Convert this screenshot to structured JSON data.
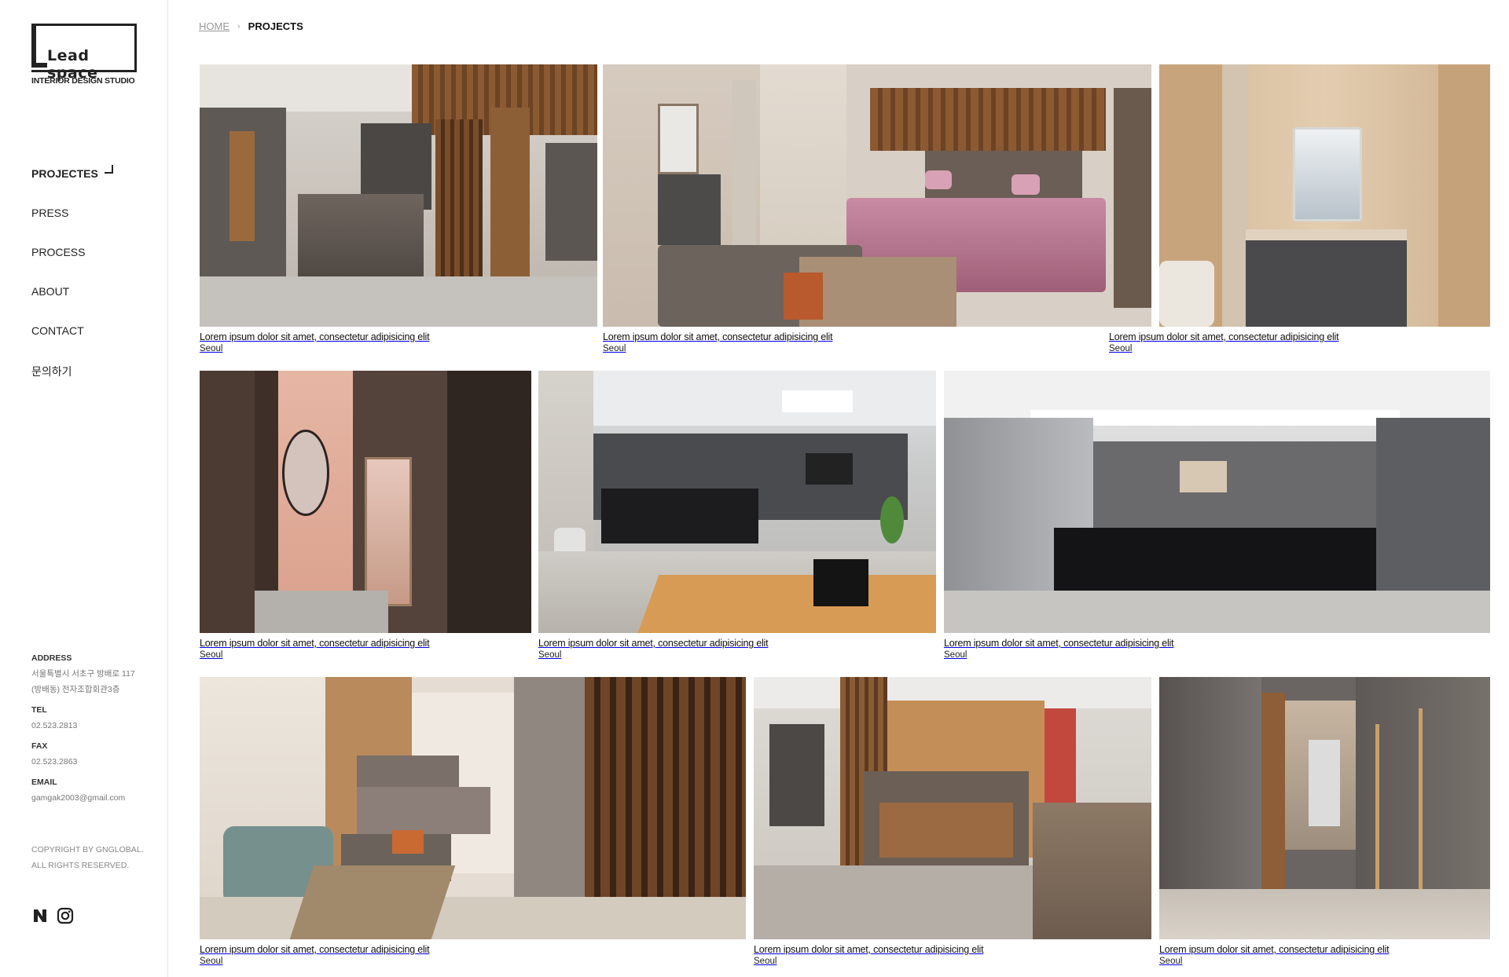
{
  "brand": {
    "logo_text": "Lead space",
    "tagline": "INTERIOR DESIGN STUDIO"
  },
  "nav": {
    "items": [
      {
        "label": "PROJECTES",
        "active": true
      },
      {
        "label": "PRESS",
        "active": false
      },
      {
        "label": "PROCESS",
        "active": false
      },
      {
        "label": "ABOUT",
        "active": false
      },
      {
        "label": "CONTACT",
        "active": false
      },
      {
        "label": "문의하기",
        "active": false
      }
    ]
  },
  "contact": {
    "address_label": "ADDRESS",
    "address_line1": "서울특별시 서초구 방배로 117",
    "address_line2": "(방배동) 전자조합회관3층",
    "tel_label": "TEL",
    "tel": "02.523.2813",
    "fax_label": "FAX",
    "fax": "02.523.2863",
    "email_label": "EMAIL",
    "email": "gamgak2003@gmail.com"
  },
  "copyright": {
    "line1": "COPYRIGHT BY GNGLOBAL.",
    "line2": "ALL RIGHTS RESERVED."
  },
  "social": {
    "icons": [
      "naver-blog-icon",
      "instagram-icon"
    ]
  },
  "breadcrumb": {
    "home": "HOME",
    "separator": "›",
    "current": "PROJECTS"
  },
  "projects": [
    {
      "title": "Lorem ipsum dolor sit amet, consectetur adipisicing elit",
      "location": "Seoul",
      "scene": "reception-wood-slats"
    },
    {
      "title": "Lorem ipsum dolor sit amet, consectetur adipisicing elit",
      "location": "Seoul",
      "scene": "bedroom-pink-bedding"
    },
    {
      "title": "Lorem ipsum dolor sit amet, consectetur adipisicing elit",
      "location": "Seoul",
      "scene": "bathroom-vanity"
    },
    {
      "title": "Lorem ipsum dolor sit amet, consectetur adipisicing elit",
      "location": "Seoul",
      "scene": "pink-powder-room"
    },
    {
      "title": "Lorem ipsum dolor sit amet, consectetur adipisicing elit",
      "location": "Seoul",
      "scene": "clinic-lobby-black-desk"
    },
    {
      "title": "Lorem ipsum dolor sit amet, consectetur adipisicing elit",
      "location": "Seoul",
      "scene": "grey-reception-hall"
    },
    {
      "title": "Lorem ipsum dolor sit amet, consectetur adipisicing elit",
      "location": "Seoul",
      "scene": "lounge-bedroom-green-chair"
    },
    {
      "title": "Lorem ipsum dolor sit amet, consectetur adipisicing elit",
      "location": "Seoul",
      "scene": "waiting-area-booths"
    },
    {
      "title": "Lorem ipsum dolor sit amet, consectetur adipisicing elit",
      "location": "Seoul",
      "scene": "marble-corridor"
    }
  ],
  "colors": {
    "text": "#222222",
    "muted": "#777777",
    "divider": "#e6e6e6"
  }
}
